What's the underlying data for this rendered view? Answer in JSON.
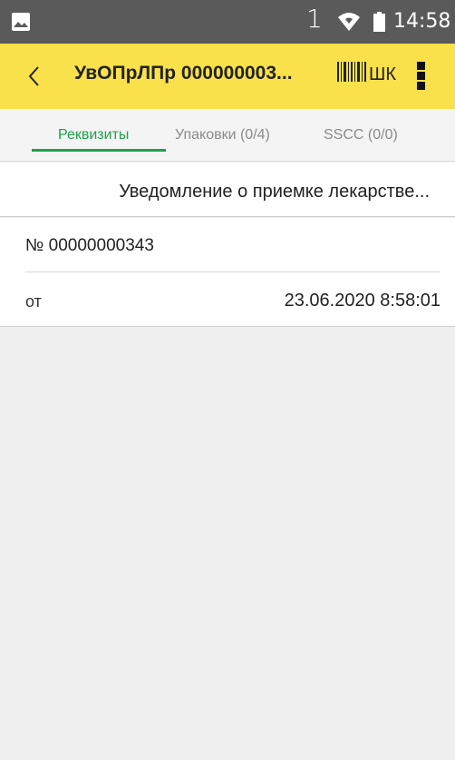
{
  "status_bar": {
    "notification_icon": "image-icon",
    "sim_indicator": "1",
    "wifi_icon": "wifi-icon",
    "battery_icon": "battery-icon",
    "time": "14:58"
  },
  "app_bar": {
    "back_icon": "chevron-left-icon",
    "title": "УвОПрЛПр 000000003...",
    "barcode_icon": "barcode-icon",
    "scan_label": "ШК",
    "menu_icon": "more-vertical-icon",
    "color": "#f9e14b"
  },
  "tabs": [
    {
      "label": "Реквизиты",
      "active": true
    },
    {
      "label": "Упаковки (0/4)",
      "active": false
    },
    {
      "label": "SSCC (0/0)",
      "active": false
    }
  ],
  "accent_color": "#1f9f4a",
  "document": {
    "name": "Уведомление о приемке лекарстве...",
    "number_label": "№ 00000000343",
    "date_label": "от",
    "date_value": "23.06.2020  8:58:01"
  }
}
